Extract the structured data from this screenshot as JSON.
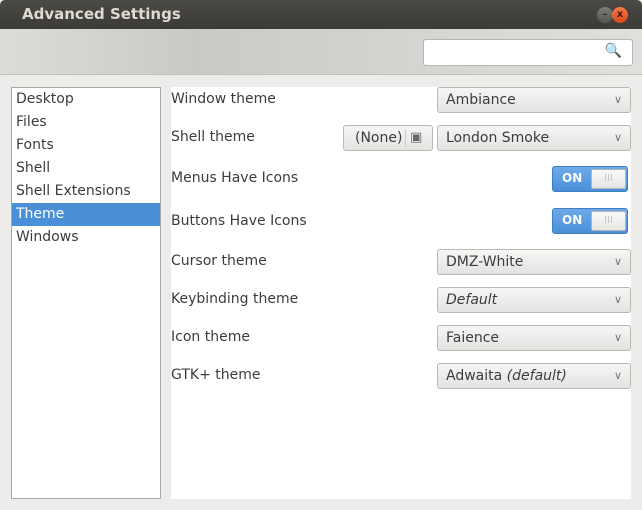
{
  "window": {
    "title": "Advanced Settings",
    "minimize_icon": "minimize-icon",
    "close_icon": "close-icon",
    "min_glyph": "–",
    "close_glyph": "x"
  },
  "search": {
    "value": "",
    "placeholder": "",
    "icon": "🔍"
  },
  "sidebar": {
    "items": [
      {
        "label": "Desktop"
      },
      {
        "label": "Files"
      },
      {
        "label": "Fonts"
      },
      {
        "label": "Shell"
      },
      {
        "label": "Shell Extensions"
      },
      {
        "label": "Theme",
        "selected": true
      },
      {
        "label": "Windows"
      }
    ]
  },
  "settings": {
    "window_theme": {
      "label": "Window theme",
      "value": "Ambiance"
    },
    "shell_theme": {
      "label": "Shell theme",
      "file_button": "(None)",
      "value": "London Smoke"
    },
    "menus_icons": {
      "label": "Menus Have Icons",
      "state": "ON"
    },
    "buttons_icons": {
      "label": "Buttons Have Icons",
      "state": "ON"
    },
    "cursor_theme": {
      "label": "Cursor theme",
      "value": "DMZ-White"
    },
    "keybinding_theme": {
      "label": "Keybinding theme",
      "value": "Default"
    },
    "icon_theme": {
      "label": "Icon theme",
      "value": "Faience"
    },
    "gtk_theme": {
      "label": "GTK+ theme",
      "value": "Adwaita",
      "suffix": "(default)"
    }
  },
  "colors": {
    "accent": "#4a90d9",
    "titlebar": "#3c3b37",
    "close": "#e95420"
  }
}
